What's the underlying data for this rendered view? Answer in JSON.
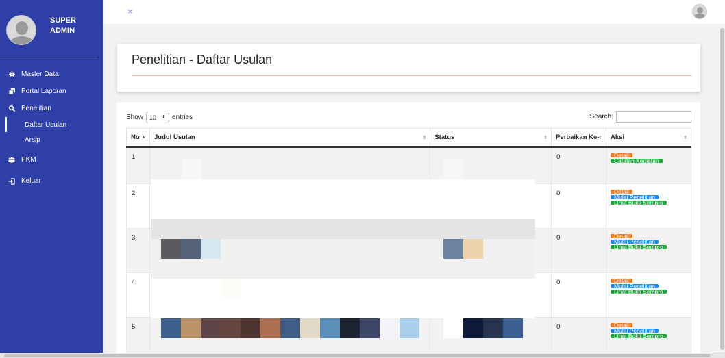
{
  "sidebar": {
    "user_name": "SUPER ADMIN",
    "menu": [
      {
        "label": "Master Data",
        "icon": "gear-icon"
      },
      {
        "label": "Portal Laporan",
        "icon": "copy-icon"
      },
      {
        "label": "Penelitian",
        "icon": "search-icon"
      }
    ],
    "submenu": [
      {
        "label": "Daftar Usulan"
      },
      {
        "label": "Arsip"
      }
    ],
    "menu2": [
      {
        "label": "PKM",
        "icon": "users-icon"
      },
      {
        "label": "Keluar",
        "icon": "sign-out-icon"
      }
    ]
  },
  "topbar": {
    "close_glyph": "×"
  },
  "page": {
    "title": "Penelitian - Daftar Usulan"
  },
  "table_controls": {
    "show_label": "Show",
    "entries_value": "10",
    "entries_label": "entries",
    "search_label": "Search:"
  },
  "table": {
    "headers": [
      "No",
      "Judul Usulan",
      "Status",
      "Perbaikan Ke-",
      "Aksi"
    ],
    "rows": [
      {
        "no": "1",
        "perbaikan": "0",
        "buttons": [
          {
            "label": "Detail",
            "kind": "detail"
          },
          {
            "label": "Catatan Kegiatan",
            "kind": "green"
          }
        ]
      },
      {
        "no": "2",
        "perbaikan": "0",
        "buttons": [
          {
            "label": "Detail",
            "kind": "detail"
          },
          {
            "label": "Mulai Penelitian",
            "kind": "blue"
          },
          {
            "label": "Lihat Bukti Sempro",
            "kind": "green"
          }
        ]
      },
      {
        "no": "3",
        "perbaikan": "0",
        "buttons": [
          {
            "label": "Detail",
            "kind": "detail"
          },
          {
            "label": "Mulai Penelitian",
            "kind": "blue"
          },
          {
            "label": "Lihat Bukti Sempro",
            "kind": "green"
          }
        ]
      },
      {
        "no": "4",
        "perbaikan": "0",
        "buttons": [
          {
            "label": "Detail",
            "kind": "detail"
          },
          {
            "label": "Mulai Penelitian",
            "kind": "blue"
          },
          {
            "label": "Lihat Bukti Sempro",
            "kind": "green"
          }
        ]
      },
      {
        "no": "5",
        "perbaikan": "0",
        "buttons": [
          {
            "label": "Detail",
            "kind": "detail"
          },
          {
            "label": "Mulai Penelitian",
            "kind": "blue"
          },
          {
            "label": "Lihat Bukti Sempro",
            "kind": "green"
          }
        ]
      }
    ]
  },
  "colors": {
    "sidebar_bg": "#2f3fa8",
    "detail_btn": "#f47b20",
    "blue_btn": "#1e88f0",
    "green_btn": "#22a63e"
  }
}
